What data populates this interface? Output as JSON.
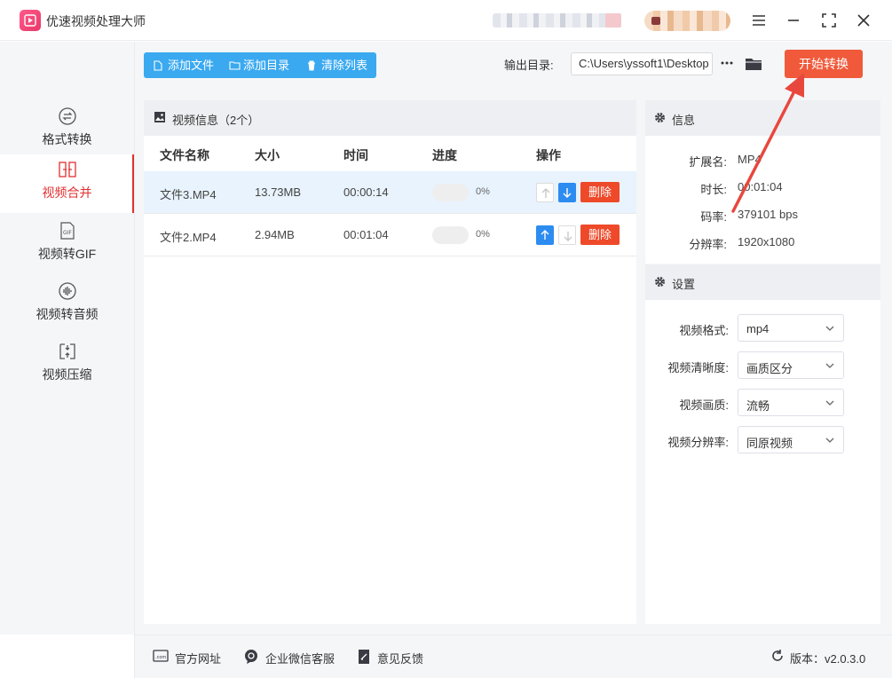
{
  "app": {
    "title": "优速视频处理大师"
  },
  "sidebar": {
    "items": [
      {
        "label": "格式转换",
        "icon": "format-convert-icon",
        "active": false
      },
      {
        "label": "视频合并",
        "icon": "video-merge-icon",
        "active": true
      },
      {
        "label": "视频转GIF",
        "icon": "gif-icon",
        "active": false
      },
      {
        "label": "视频转音频",
        "icon": "audio-icon",
        "active": false
      },
      {
        "label": "视频压缩",
        "icon": "compress-icon",
        "active": false
      }
    ]
  },
  "toolbar": {
    "add_file": "添加文件",
    "add_folder": "添加目录",
    "clear_list": "清除列表",
    "output_label": "输出目录:",
    "output_path": "C:\\Users\\yssoft1\\Desktop",
    "start_button": "开始转换"
  },
  "file_panel": {
    "title": "视频信息（2个）",
    "columns": [
      "文件名称",
      "大小",
      "时间",
      "进度",
      "操作"
    ],
    "rows": [
      {
        "name": "文件3.MP4",
        "size": "13.73MB",
        "time": "00:00:14",
        "progress": 0,
        "progress_text": "0%",
        "delete": "删除",
        "selected": true,
        "up_enabled": false,
        "down_enabled": true
      },
      {
        "name": "文件2.MP4",
        "size": "2.94MB",
        "time": "00:01:04",
        "progress": 0,
        "progress_text": "0%",
        "delete": "删除",
        "selected": false,
        "up_enabled": true,
        "down_enabled": false
      }
    ]
  },
  "info_panel": {
    "title": "信息",
    "fields": [
      {
        "key": "扩展名:",
        "value": "MP4"
      },
      {
        "key": "时长:",
        "value": "00:01:04"
      },
      {
        "key": "码率:",
        "value": "379101 bps"
      },
      {
        "key": "分辨率:",
        "value": "1920x1080"
      }
    ]
  },
  "settings_panel": {
    "title": "设置",
    "fields": [
      {
        "key": "视频格式:",
        "value": "mp4"
      },
      {
        "key": "视频清晰度:",
        "value": "画质区分"
      },
      {
        "key": "视频画质:",
        "value": "流畅"
      },
      {
        "key": "视频分辨率:",
        "value": "同原视频"
      }
    ]
  },
  "footer": {
    "website": "官方网址",
    "wechat": "企业微信客服",
    "feedback": "意见反馈",
    "version": "版本：v2.0.3.0"
  },
  "colors": {
    "accent_blue": "#3aa9f0",
    "start_orange": "#f05a3b",
    "delete_red": "#ee4a2a",
    "active_red": "#e0312f",
    "annotation_red": "#e8473e"
  }
}
